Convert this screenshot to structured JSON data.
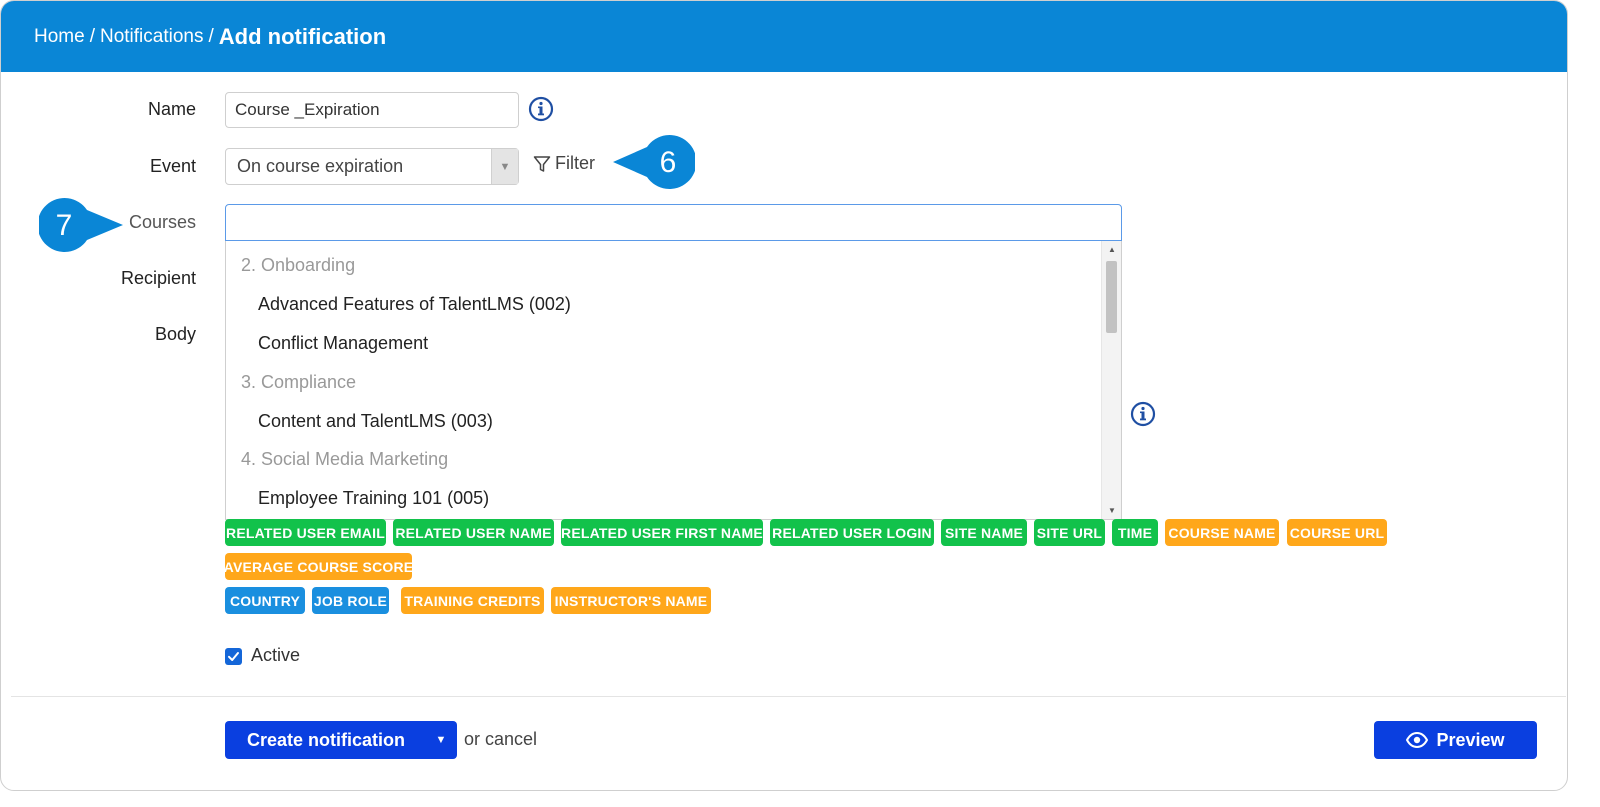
{
  "breadcrumb": {
    "home": "Home",
    "notifications": "Notifications",
    "current": "Add notification",
    "separator": "/"
  },
  "form": {
    "name_label": "Name",
    "name_value": "Course _Expiration",
    "event_label": "Event",
    "event_value": "On course expiration",
    "filter_label": "Filter",
    "courses_label": "Courses",
    "courses_value": "",
    "recipient_label": "Recipient",
    "body_label": "Body"
  },
  "callouts": {
    "filter_step": "6",
    "courses_step": "7",
    "color": "#0a86d6"
  },
  "courses_dropdown": {
    "groups": [
      {
        "label": "2. Onboarding",
        "options": [
          "Advanced Features of TalentLMS (002)",
          "Conflict Management"
        ]
      },
      {
        "label": "3. Compliance",
        "options": [
          "Content and TalentLMS (003)"
        ]
      },
      {
        "label": "4. Social Media Marketing",
        "options": [
          "Employee Training 101 (005)"
        ]
      }
    ]
  },
  "tags": {
    "row1": [
      {
        "text": "RELATED USER EMAIL",
        "color": "green"
      },
      {
        "text": "RELATED USER NAME",
        "color": "green"
      },
      {
        "text": "RELATED USER FIRST NAME",
        "color": "green"
      },
      {
        "text": "RELATED USER LOGIN",
        "color": "green"
      },
      {
        "text": "SITE NAME",
        "color": "green"
      },
      {
        "text": "SITE URL",
        "color": "green"
      },
      {
        "text": "TIME",
        "color": "green"
      },
      {
        "text": "COURSE NAME",
        "color": "orange"
      },
      {
        "text": "COURSE URL",
        "color": "orange"
      }
    ],
    "row2": [
      {
        "text": "AVERAGE COURSE SCORE",
        "color": "orange"
      }
    ],
    "row3": [
      {
        "text": "COUNTRY",
        "color": "blue"
      },
      {
        "text": "JOB ROLE",
        "color": "blue"
      },
      {
        "text": "TRAINING CREDITS",
        "color": "orange"
      },
      {
        "text": "INSTRUCTOR'S NAME",
        "color": "orange"
      }
    ]
  },
  "active": {
    "label": "Active",
    "checked": true
  },
  "actions": {
    "create_label": "Create notification",
    "cancel_text": "or cancel",
    "preview_label": "Preview"
  },
  "icons": {
    "info": "info-icon",
    "filter": "filter-icon",
    "eye": "eye-icon",
    "check": "check-icon"
  },
  "colors": {
    "header": "#0a86d6",
    "primary_button": "#0a3fe0",
    "tag_green": "#12c24b",
    "tag_orange": "#ffa71a",
    "tag_blue": "#1a8fdf"
  }
}
